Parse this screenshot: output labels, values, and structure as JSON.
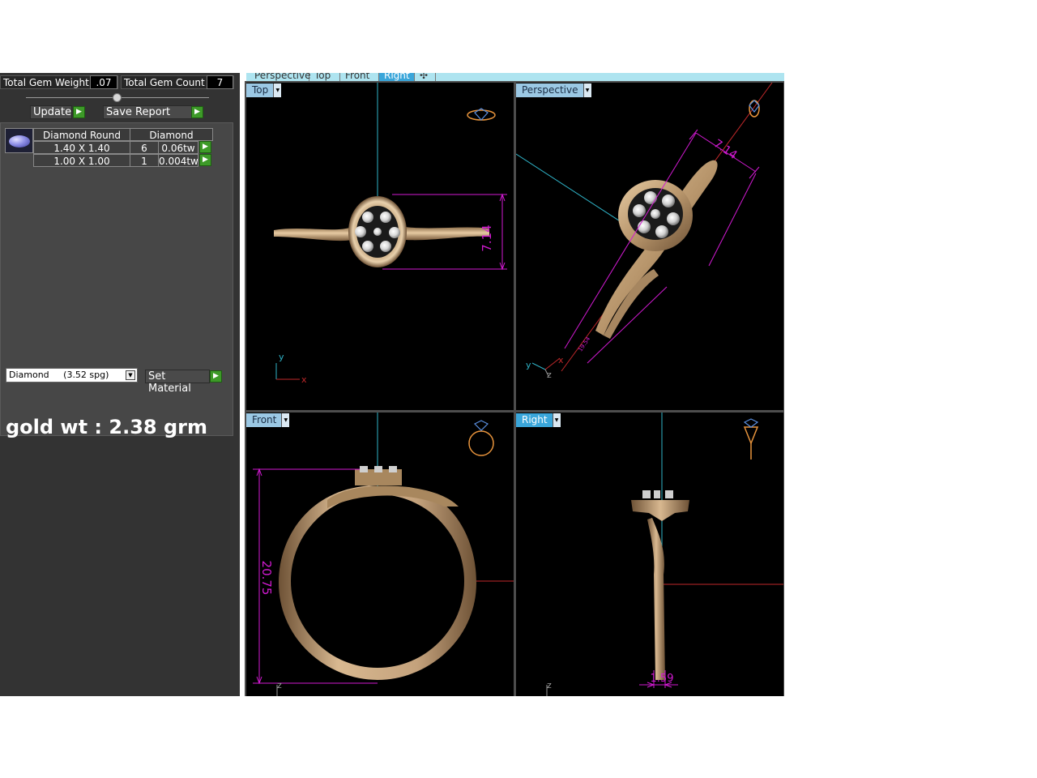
{
  "summary": {
    "gem_weight_label": "Total Gem Weight",
    "gem_weight_value": ".07",
    "gem_count_label": "Total Gem Count",
    "gem_count_value": "7"
  },
  "actions": {
    "update_label": "Update",
    "save_report_label": "Save Report",
    "set_material_label": "Set Material"
  },
  "gem_table": {
    "headers": [
      "Diamond Round",
      "Diamond"
    ],
    "rows": [
      {
        "size": "1.40 X 1.40",
        "count": "6",
        "weight": "0.06tw"
      },
      {
        "size": "1.00 X 1.00",
        "count": "1",
        "weight": "0.004tw"
      }
    ]
  },
  "material": {
    "selected": "Diamond     (3.52 spg)"
  },
  "note": "gold wt : 2.38 grm",
  "view_tabs": [
    "Perspective",
    "Top",
    "Front",
    "Right",
    "✣"
  ],
  "active_view_tab": "Right",
  "viewports": {
    "top": {
      "label": "Top",
      "dimension": "7.14",
      "axis_y": "y",
      "axis_x": "x"
    },
    "perspective": {
      "label": "Perspective",
      "dimension": "7.14",
      "dimension_small": "19.54",
      "axis_y": "y",
      "axis_z": "z",
      "axis_x": "x"
    },
    "front": {
      "label": "Front",
      "dimension": "20.75",
      "axis_z": "z"
    },
    "right": {
      "label": "Right",
      "dimension": "1.59",
      "axis_z": "z"
    }
  },
  "colors": {
    "gold": "#c4a27c",
    "dimension": "#d21ad2",
    "axis_blue": "#2fb4c8",
    "axis_red": "#c0282a",
    "viewport_active": "#3aa6da"
  }
}
